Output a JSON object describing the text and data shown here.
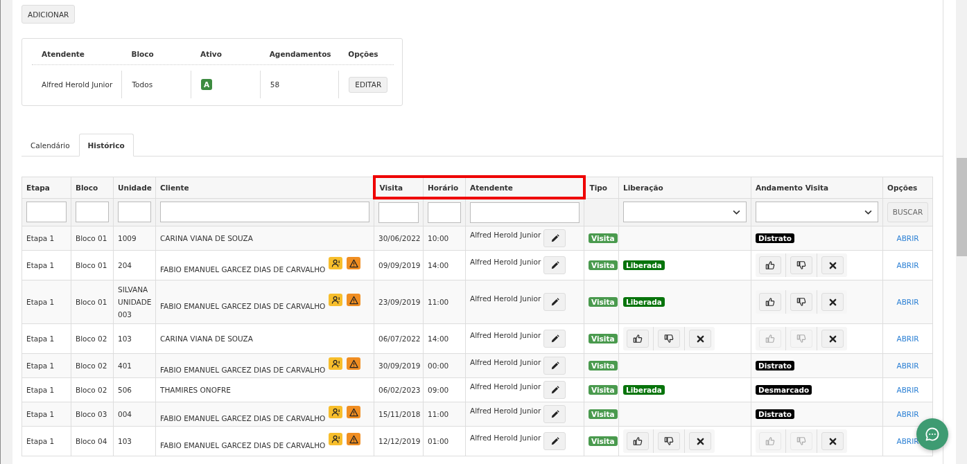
{
  "add_button": "ADICIONAR",
  "summary": {
    "columns": [
      "Atendente",
      "Bloco",
      "Ativo",
      "Agendamentos",
      "Opções"
    ],
    "row": {
      "atendente": "Alfred Herold Junior",
      "bloco": "Todos",
      "ativo": "A",
      "agendamentos": "58",
      "action": "EDITAR"
    }
  },
  "tabs": [
    {
      "label": "Calendário",
      "selected": false
    },
    {
      "label": "Histórico",
      "selected": true
    }
  ],
  "table": {
    "columns": [
      {
        "label": "Etapa",
        "highlighted": false,
        "filter": {
          "kind": "text"
        }
      },
      {
        "label": "Bloco",
        "highlighted": false,
        "filter": {
          "kind": "text"
        }
      },
      {
        "label": "Unidade",
        "highlighted": false,
        "filter": {
          "kind": "text"
        }
      },
      {
        "label": "Cliente",
        "highlighted": false,
        "filter": {
          "kind": "text"
        }
      },
      {
        "label": "Visita",
        "highlighted": true,
        "filter": {
          "kind": "text"
        }
      },
      {
        "label": "Horário",
        "highlighted": true,
        "filter": {
          "kind": "text"
        }
      },
      {
        "label": "Atendente",
        "highlighted": true,
        "filter": {
          "kind": "text"
        }
      },
      {
        "label": "Tipo",
        "highlighted": false,
        "filter": {
          "kind": "none"
        }
      },
      {
        "label": "Liberação",
        "highlighted": false,
        "filter": {
          "kind": "select"
        }
      },
      {
        "label": "Andamento Visita",
        "highlighted": false,
        "filter": {
          "kind": "select"
        }
      },
      {
        "label": "Opções",
        "highlighted": false,
        "filter": {
          "kind": "button",
          "label": "BUSCAR"
        }
      }
    ],
    "rows": [
      {
        "etapa": "Etapa 1",
        "bloco": "Bloco 01",
        "unidade": "1009",
        "cliente": "CARINA VIANA DE SOUZA",
        "alerts": false,
        "visita": "30/06/2022",
        "horario": "10:00",
        "atendente": "Alfred Herold Junior",
        "tipo": "Visita",
        "liberacao": {
          "kind": "none"
        },
        "andamento": {
          "kind": "badge",
          "text": "Distrato"
        },
        "action": "ABRIR"
      },
      {
        "etapa": "Etapa 1",
        "bloco": "Bloco 01",
        "unidade": "204",
        "cliente": "FABIO EMANUEL GARCEZ DIAS DE CARVALHO",
        "alerts": true,
        "visita": "09/09/2019",
        "horario": "14:00",
        "atendente": "Alfred Herold Junior",
        "tipo": "Visita",
        "liberacao": {
          "kind": "badge",
          "text": "Liberada"
        },
        "andamento": {
          "kind": "vote",
          "disabled": false
        },
        "action": "ABRIR"
      },
      {
        "etapa": "Etapa 1",
        "bloco": "Bloco 01",
        "unidade": "SILVANA UNIDADE 003",
        "cliente": "FABIO EMANUEL GARCEZ DIAS DE CARVALHO",
        "alerts": true,
        "visita": "23/09/2019",
        "horario": "11:00",
        "atendente": "Alfred Herold Junior",
        "tipo": "Visita",
        "liberacao": {
          "kind": "badge",
          "text": "Liberada"
        },
        "andamento": {
          "kind": "vote",
          "disabled": false
        },
        "action": "ABRIR"
      },
      {
        "etapa": "Etapa 1",
        "bloco": "Bloco 02",
        "unidade": "103",
        "cliente": "CARINA VIANA DE SOUZA",
        "alerts": false,
        "visita": "06/07/2022",
        "horario": "14:00",
        "atendente": "Alfred Herold Junior",
        "tipo": "Visita",
        "liberacao": {
          "kind": "vote",
          "disabled": false
        },
        "andamento": {
          "kind": "vote",
          "disabled": true
        },
        "action": "ABRIR"
      },
      {
        "etapa": "Etapa 1",
        "bloco": "Bloco 02",
        "unidade": "401",
        "cliente": "FABIO EMANUEL GARCEZ DIAS DE CARVALHO",
        "alerts": true,
        "visita": "30/09/2019",
        "horario": "00:00",
        "atendente": "Alfred Herold Junior",
        "tipo": "Visita",
        "liberacao": {
          "kind": "none"
        },
        "andamento": {
          "kind": "badge",
          "text": "Distrato"
        },
        "action": "ABRIR"
      },
      {
        "etapa": "Etapa 1",
        "bloco": "Bloco 02",
        "unidade": "506",
        "cliente": "THAMIRES ONOFRE",
        "alerts": false,
        "visita": "06/02/2023",
        "horario": "09:00",
        "atendente": "Alfred Herold Junior",
        "tipo": "Visita",
        "liberacao": {
          "kind": "badge",
          "text": "Liberada"
        },
        "andamento": {
          "kind": "badge",
          "text": "Desmarcado"
        },
        "action": "ABRIR"
      },
      {
        "etapa": "Etapa 1",
        "bloco": "Bloco 03",
        "unidade": "004",
        "cliente": "FABIO EMANUEL GARCEZ DIAS DE CARVALHO",
        "alerts": true,
        "visita": "15/11/2018",
        "horario": "11:00",
        "atendente": "Alfred Herold Junior",
        "tipo": "Visita",
        "liberacao": {
          "kind": "none"
        },
        "andamento": {
          "kind": "badge",
          "text": "Distrato"
        },
        "action": "ABRIR"
      },
      {
        "etapa": "Etapa 1",
        "bloco": "Bloco 04",
        "unidade": "103",
        "cliente": "FABIO EMANUEL GARCEZ DIAS DE CARVALHO",
        "alerts": true,
        "visita": "12/12/2019",
        "horario": "01:00",
        "atendente": "Alfred Herold Junior",
        "tipo": "Visita",
        "liberacao": {
          "kind": "vote",
          "disabled": false
        },
        "andamento": {
          "kind": "vote",
          "disabled": true
        },
        "action": "ABRIR"
      }
    ]
  }
}
